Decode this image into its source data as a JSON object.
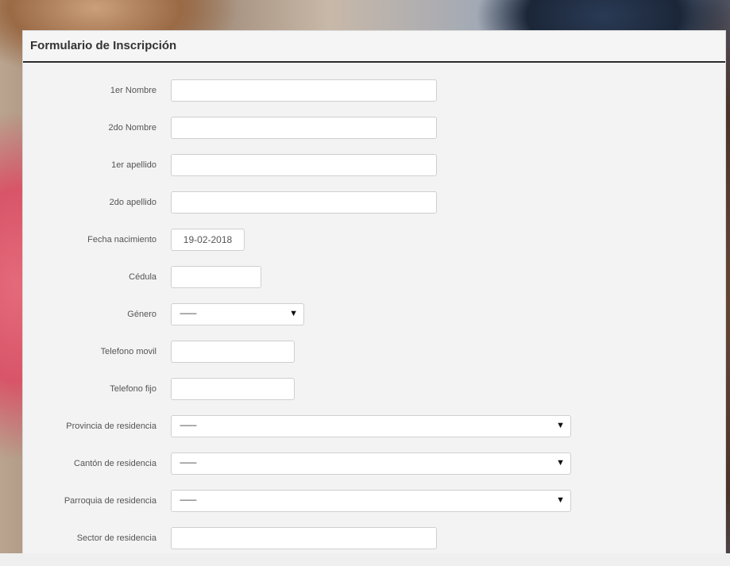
{
  "form": {
    "title": "Formulario de Inscripción",
    "fields": {
      "primer_nombre": {
        "label": "1er Nombre",
        "value": ""
      },
      "segundo_nombre": {
        "label": "2do Nombre",
        "value": ""
      },
      "primer_apellido": {
        "label": "1er apellido",
        "value": ""
      },
      "segundo_apellido": {
        "label": "2do apellido",
        "value": ""
      },
      "fecha_nacimiento": {
        "label": "Fecha nacimiento",
        "value": "19-02-2018"
      },
      "cedula": {
        "label": "Cédula",
        "value": ""
      },
      "genero": {
        "label": "Género",
        "selected": "---------"
      },
      "telefono_movil": {
        "label": "Telefono movil",
        "value": ""
      },
      "telefono_fijo": {
        "label": "Telefono fijo",
        "value": ""
      },
      "provincia": {
        "label": "Provincia de residencia",
        "selected": "---------"
      },
      "canton": {
        "label": "Cantón de residencia",
        "selected": "---------"
      },
      "parroquia": {
        "label": "Parroquia de residencia",
        "selected": "---------"
      },
      "sector": {
        "label": "Sector de residencia",
        "value": ""
      }
    },
    "dropdown_icon": "▼"
  }
}
